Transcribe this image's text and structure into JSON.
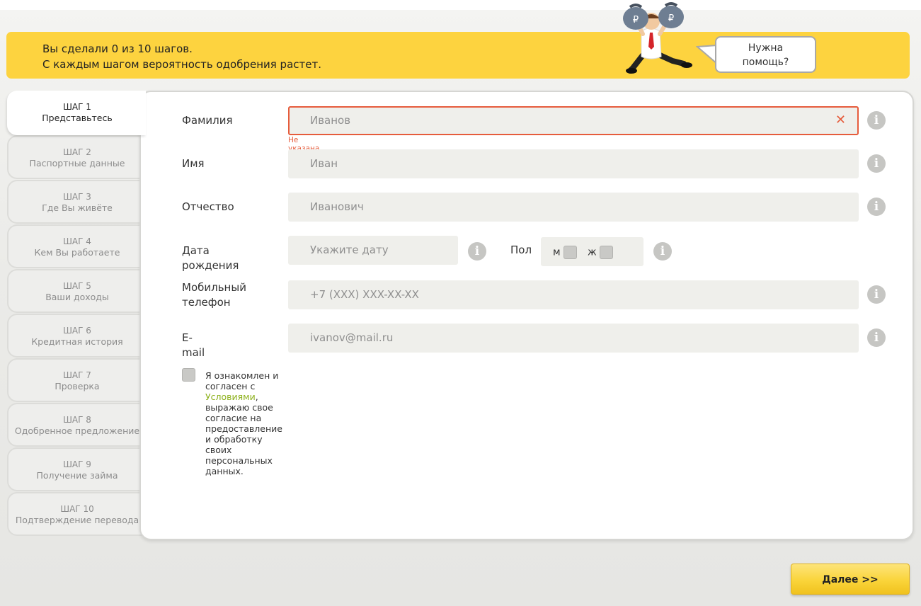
{
  "progress": {
    "line1": "Вы сделали 0 из 10 шагов.",
    "line2": "С каждым шагом вероятность одобрения растет."
  },
  "help": {
    "line1": "Нужна",
    "line2": "помощь?"
  },
  "steps": [
    {
      "num": "ШАГ 1",
      "label": "Представьтесь"
    },
    {
      "num": "ШАГ 2",
      "label": "Паспортные данные"
    },
    {
      "num": "ШАГ 3",
      "label": "Где Вы живёте"
    },
    {
      "num": "ШАГ 4",
      "label": "Кем Вы работаете"
    },
    {
      "num": "ШАГ 5",
      "label": "Ваши доходы"
    },
    {
      "num": "ШАГ 6",
      "label": "Кредитная история"
    },
    {
      "num": "ШАГ 7",
      "label": "Проверка"
    },
    {
      "num": "ШАГ 8",
      "label": "Одобренное предложение"
    },
    {
      "num": "ШАГ 9",
      "label": "Получение займа"
    },
    {
      "num": "ШАГ 10",
      "label": "Подтверждение перевода"
    }
  ],
  "active_step": 1,
  "form": {
    "surname": {
      "label": "Фамилия",
      "placeholder": "Иванов",
      "error": "Не указана фамилия"
    },
    "name": {
      "label": "Имя",
      "placeholder": "Иван"
    },
    "patronymic": {
      "label": "Отчество",
      "placeholder": "Иванович"
    },
    "birthdate": {
      "label": "Дата рождения",
      "placeholder": "Укажите дату"
    },
    "gender": {
      "label": "Пол",
      "male": "м",
      "female": "ж"
    },
    "phone": {
      "label_line1": "Мобильный",
      "label_line2": "телефон",
      "placeholder": "+7 (XXX) XXX-XX-XX"
    },
    "email": {
      "label": "E-mail",
      "placeholder": "ivanov@mail.ru"
    },
    "consent": {
      "before": "Я ознакомлен и согласен с ",
      "link": "Условиями",
      "after": ", выражаю свое согласие на предоставление и обработку своих персональных данных."
    }
  },
  "icons": {
    "clear": "close-icon",
    "info": "info-icon"
  },
  "colors": {
    "banner": "#fdd33f",
    "error": "#e65c3c",
    "link": "#8db11b",
    "button": "#fad43a"
  },
  "next_label": "Далее >>"
}
